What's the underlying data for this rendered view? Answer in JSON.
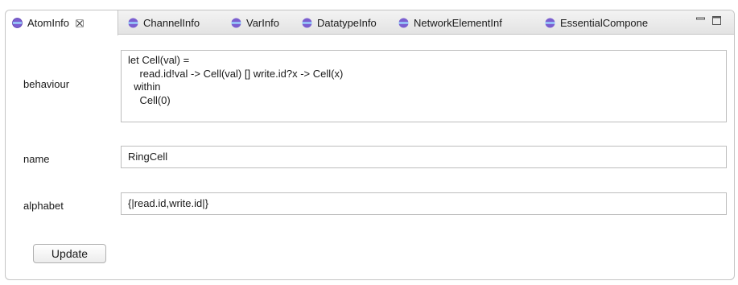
{
  "tabs": [
    {
      "label": "AtomInfo",
      "active": true,
      "closable": true
    },
    {
      "label": "ChannelInfo",
      "active": false
    },
    {
      "label": "VarInfo",
      "active": false
    },
    {
      "label": "DatatypeInfo",
      "active": false
    },
    {
      "label": "NetworkElementInf",
      "active": false
    },
    {
      "label": "EssentialCompone",
      "active": false
    }
  ],
  "form": {
    "behaviour": {
      "label": "behaviour",
      "value": "let Cell(val) =\n    read.id!val -> Cell(val) [] write.id?x -> Cell(x)\n  within\n    Cell(0)"
    },
    "name": {
      "label": "name",
      "value": "RingCell"
    },
    "alphabet": {
      "label": "alphabet",
      "value": "{|read.id,write.id|}"
    }
  },
  "update_button": "Update",
  "colors": {
    "icon_purple": "#7b5fd0",
    "icon_band": "#9bd4ff",
    "border": "#c4c4c4",
    "tabbar_bg": "#e8e8e8"
  },
  "icons": {
    "tab": "element-icon",
    "close": "close-icon",
    "minimize": "minimize-icon",
    "maximize": "maximize-icon"
  }
}
